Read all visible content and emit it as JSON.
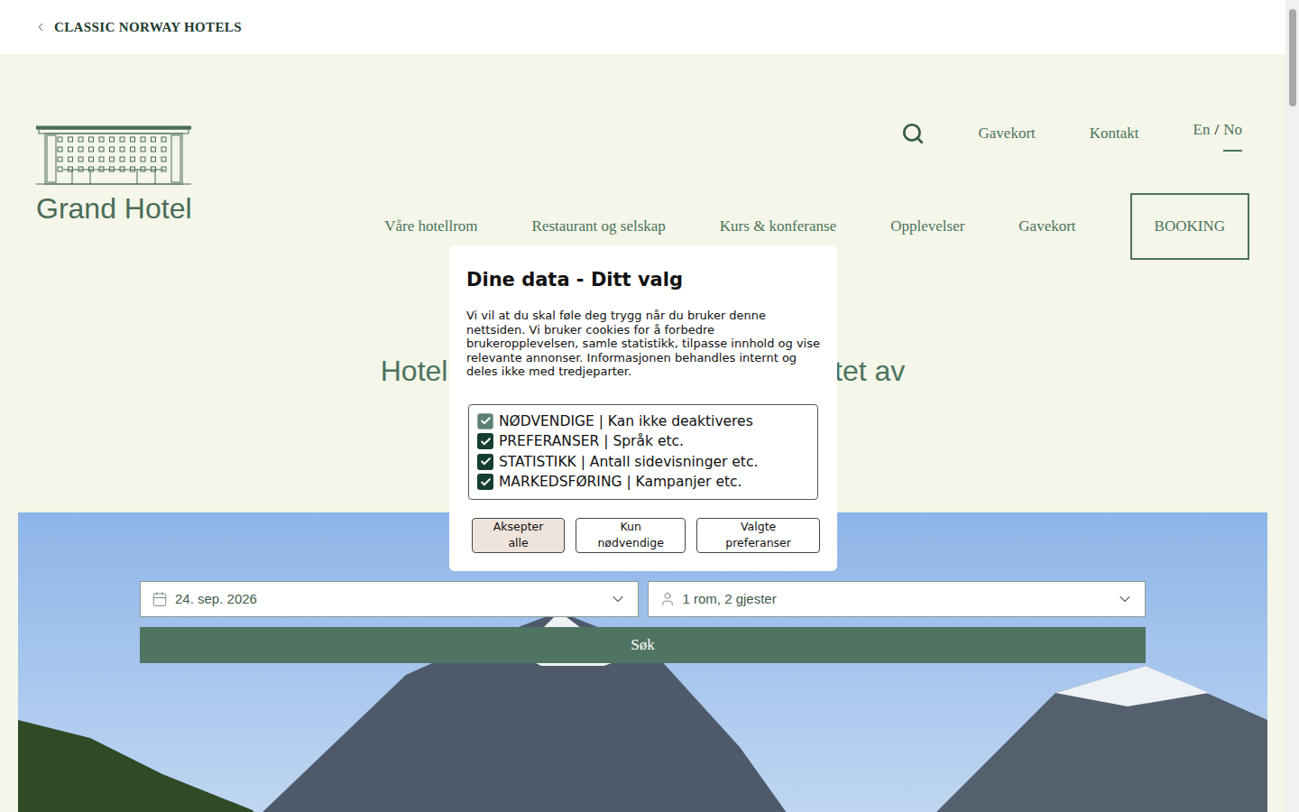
{
  "top_bar": {
    "label": "CLASSIC NORWAY HOTELS"
  },
  "logo": {
    "name": "Grand Hotel"
  },
  "utility_nav": [
    "Gavekort",
    "Kontakt"
  ],
  "language": {
    "separator": "/",
    "options": [
      {
        "label": "En",
        "selected": false
      },
      {
        "label": "No",
        "selected": true
      }
    ]
  },
  "main_nav": [
    "Våre hotellrom",
    "Restaurant og selskap",
    "Kurs & konferanse",
    "Opplevelser",
    "Gavekort"
  ],
  "booking_button": "BOOKING",
  "heading": {
    "visible_start": "Hotell i",
    "visible_end": "ertet av"
  },
  "booking_form": {
    "date": "24. sep. 2026",
    "guests": "1 rom, 2 gjester",
    "search_button": "Søk"
  },
  "cookie_dialog": {
    "title": "Dine data - Ditt valg",
    "text": "Vi vil at du skal føle deg trygg når du bruker denne nettsiden. Vi bruker cookies for å forbedre brukeropplevelsen, samle statistikk, tilpasse innhold og vise relevante annonser. Informasjonen behandles internt og deles ikke med tredjeparter.",
    "options": [
      {
        "label": "NØDVENDIGE | Kan ikke deaktiveres",
        "checked": true,
        "disabled": true
      },
      {
        "label": "PREFERANSER | Språk etc.",
        "checked": true,
        "disabled": false
      },
      {
        "label": "STATISTIKK | Antall sidevisninger etc.",
        "checked": true,
        "disabled": false
      },
      {
        "label": "MARKEDSFØRING | Kampanjer etc.",
        "checked": true,
        "disabled": false
      }
    ],
    "buttons": [
      {
        "label": "Aksepter alle",
        "primary": true
      },
      {
        "label": "Kun nødvendige",
        "primary": false
      },
      {
        "label": "Valgte preferanser",
        "primary": false
      }
    ]
  }
}
